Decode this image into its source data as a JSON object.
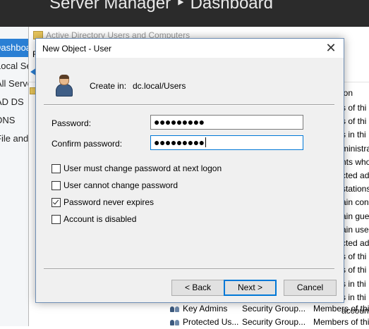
{
  "server_manager": {
    "breadcrumb": "Server Manager ‣ Dashboard",
    "nav": [
      {
        "label": "Dashboard",
        "active": true
      },
      {
        "label": "Local Server",
        "active": false
      },
      {
        "label": "All Servers",
        "active": false
      },
      {
        "label": "AD DS",
        "active": false
      },
      {
        "label": "DNS",
        "active": false
      },
      {
        "label": "File and Storage Services",
        "active": false
      }
    ]
  },
  "aduc": {
    "title": "Active Directory Users and Computers",
    "menu_first": "F",
    "column_partial": "ion",
    "right_fragments": [
      "s of thi",
      "s of thi",
      "s in thi",
      "ministra",
      "nts who",
      "cted adm",
      "stations",
      "ain con",
      "ain gue",
      "ain user",
      "cted adm",
      "s of thi",
      "s of thi",
      "s in thi",
      "s in thi",
      "accoun"
    ],
    "rows": [
      {
        "name": "Key Admins",
        "type": "Security Group...",
        "description": "Members of thi"
      },
      {
        "name": "Protected Us...",
        "type": "Security Group...",
        "description": "Members of thi"
      }
    ]
  },
  "dialog": {
    "title": "New Object - User",
    "create_in_label": "Create in:",
    "create_in_value": "dc.local/Users",
    "password_label": "Password:",
    "password_value": "●●●●●●●●●",
    "confirm_label": "Confirm password:",
    "confirm_value": "●●●●●●●●●",
    "checkboxes": [
      {
        "label": "User must change password at next logon",
        "checked": false
      },
      {
        "label": "User cannot change password",
        "checked": false
      },
      {
        "label": "Password never expires",
        "checked": true
      },
      {
        "label": "Account is disabled",
        "checked": false
      }
    ],
    "buttons": {
      "back": "< Back",
      "next": "Next >",
      "cancel": "Cancel"
    },
    "close_glyph": "✕"
  }
}
